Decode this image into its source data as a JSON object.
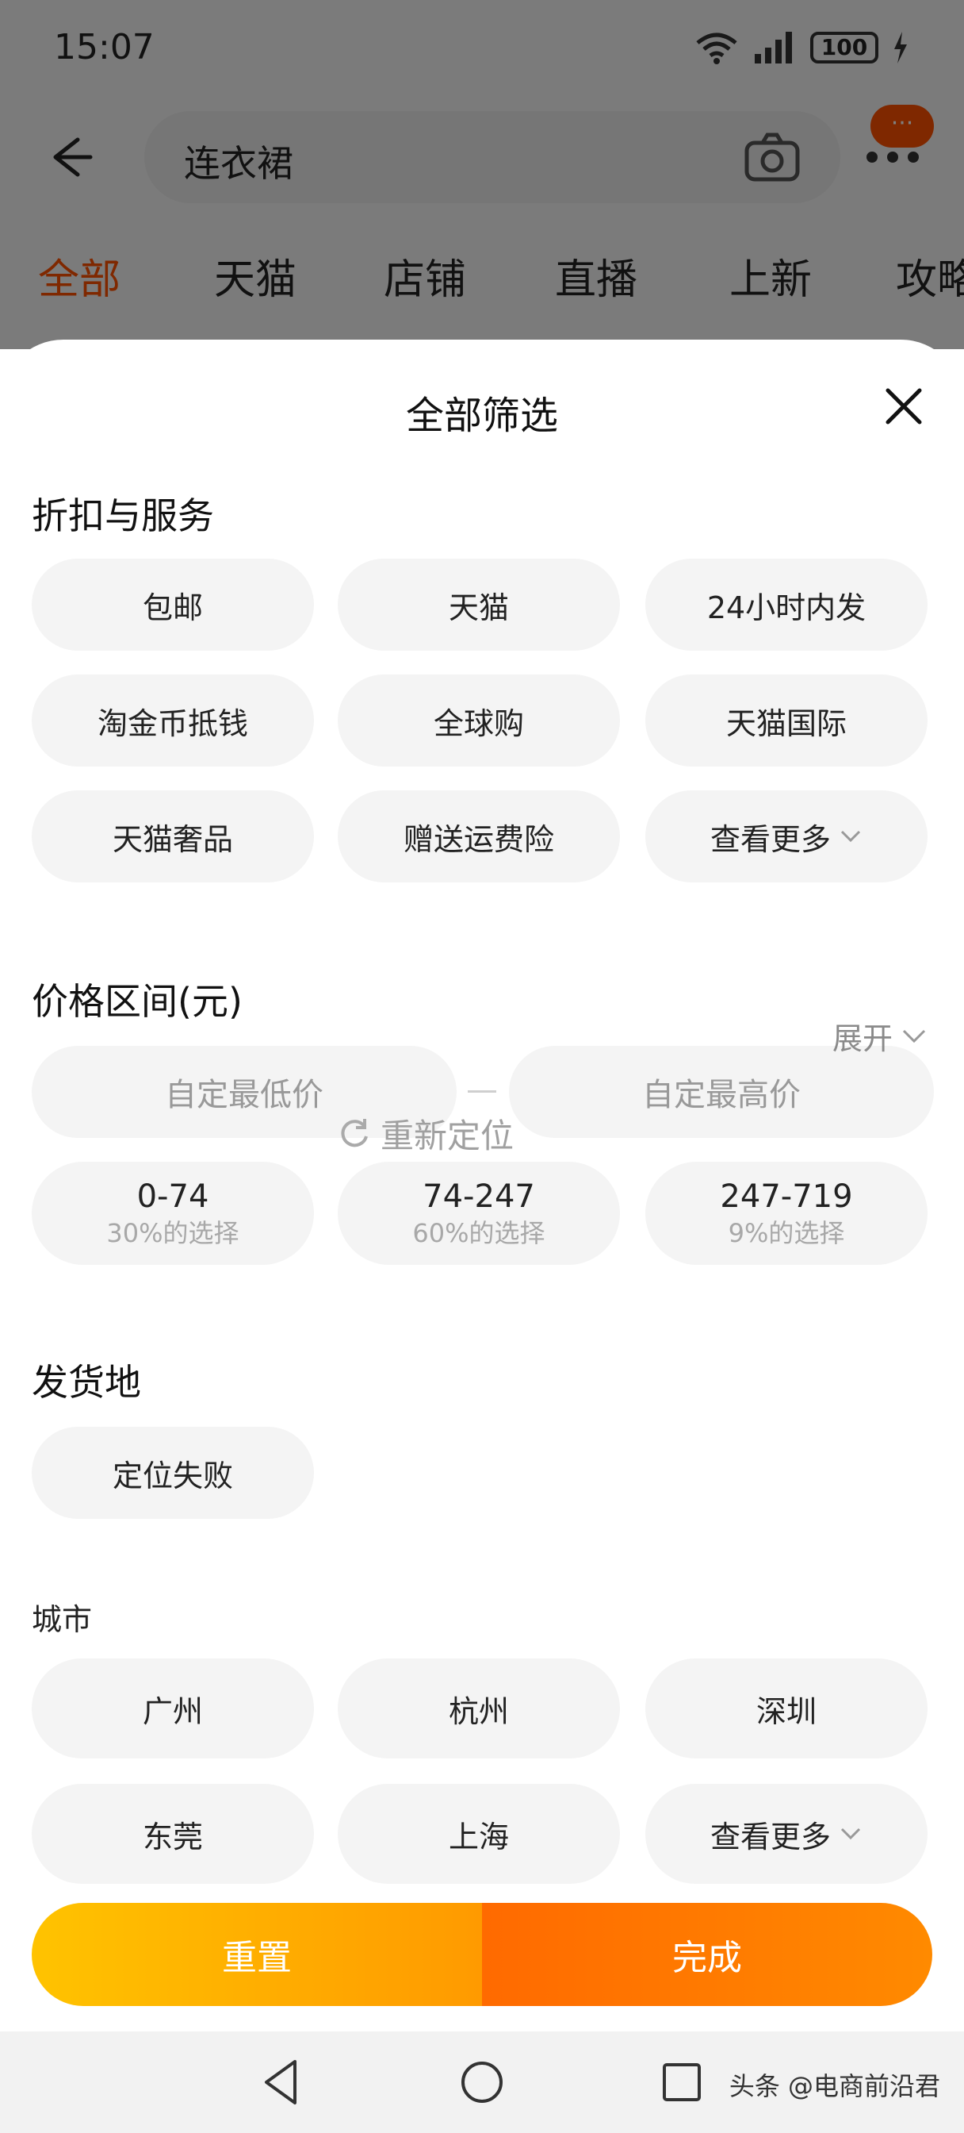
{
  "status_bar": {
    "time": "15:07",
    "battery": "100"
  },
  "search": {
    "query": "连衣裙"
  },
  "message_badge": "···",
  "top_tabs": [
    "全部",
    "天猫",
    "店铺",
    "直播",
    "上新",
    "攻略"
  ],
  "sheet": {
    "title": "全部筛选",
    "discount_section": {
      "title": "折扣与服务",
      "chips": [
        "包邮",
        "天猫",
        "24小时内发",
        "淘金币抵钱",
        "全球购",
        "天猫国际",
        "天猫奢品",
        "赠送运费险",
        "查看更多"
      ]
    },
    "price_section": {
      "title": "价格区间(元)",
      "min_placeholder": "自定最低价",
      "max_placeholder": "自定最高价",
      "ranges": [
        {
          "range": "0-74",
          "share": "30%的选择"
        },
        {
          "range": "74-247",
          "share": "60%的选择"
        },
        {
          "range": "247-719",
          "share": "9%的选择"
        }
      ]
    },
    "ship_from_section": {
      "title": "发货地",
      "expand_label": "展开",
      "location_status": "定位失败",
      "relocate_label": "重新定位",
      "city_title": "城市",
      "cities": [
        "广州",
        "杭州",
        "深圳",
        "东莞",
        "上海",
        "查看更多"
      ]
    },
    "actions": {
      "reset": "重置",
      "done": "完成"
    }
  },
  "watermark": "头条 @电商前沿君",
  "colors": {
    "accent": "#ff5000",
    "reset_gradient": "#ffc300",
    "done_gradient": "#ff6a00"
  }
}
